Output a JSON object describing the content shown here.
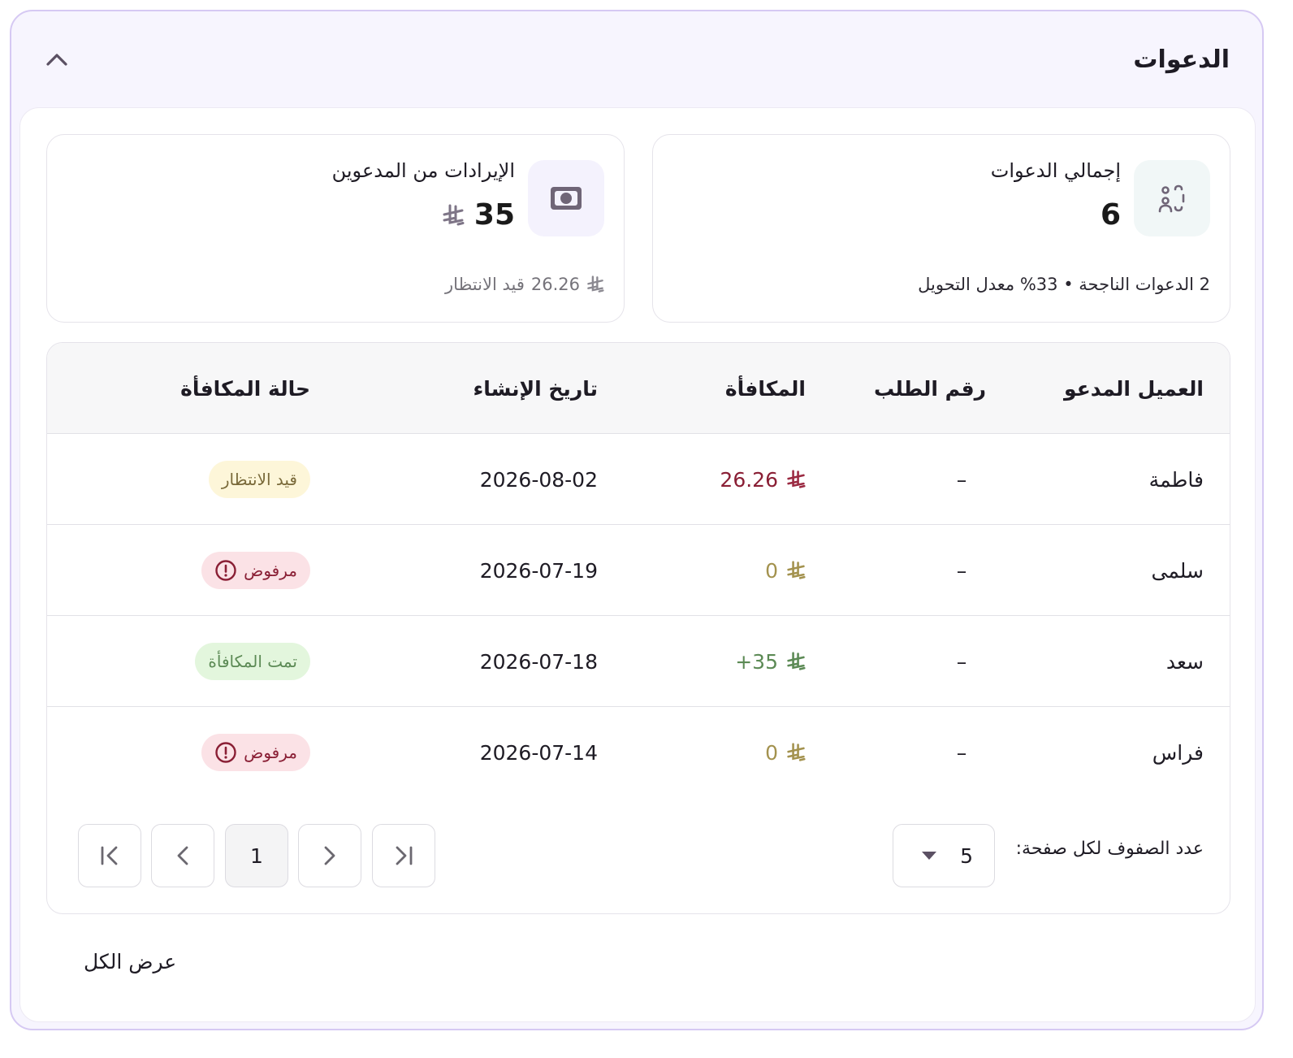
{
  "header": {
    "title": "الدعوات"
  },
  "total_invites": {
    "label": "إجمالي الدعوات",
    "value": "6",
    "summary": "2 الدعوات الناجحة • 33% معدل التحويل"
  },
  "revenue": {
    "label": "الإيرادات من المدعوين",
    "value": "35",
    "pending_amount": "26.26",
    "pending_label": "قيد الانتظار"
  },
  "table": {
    "headers": {
      "invited_customer": "العميل المدعو",
      "order_number": "رقم الطلب",
      "reward": "المكافأة",
      "created_date": "تاريخ الإنشاء",
      "reward_status": "حالة المكافأة"
    },
    "rows": [
      {
        "name": "فاطمة",
        "order": "–",
        "reward": "26.26",
        "date": "2026-08-02",
        "status": "قيد الانتظار"
      },
      {
        "name": "سلمى",
        "order": "–",
        "reward": "0",
        "date": "2026-07-19",
        "status": "مرفوض"
      },
      {
        "name": "سعد",
        "order": "–",
        "reward": "+35",
        "date": "2026-07-18",
        "status": "تمت المكافأة"
      },
      {
        "name": "فراس",
        "order": "–",
        "reward": "0",
        "date": "2026-07-14",
        "status": "مرفوض"
      }
    ]
  },
  "pagination": {
    "rows_per_page_label": "عدد الصفوف لكل صفحة:",
    "rows_per_page": "5",
    "current_page": "1"
  },
  "footer": {
    "view_all": "عرض الكل"
  },
  "colors": {
    "accent_border": "#d6c9f3",
    "panel_bg": "#f7f5fe",
    "reward_pending": "#8a1f35",
    "reward_zero": "#a3924e",
    "reward_positive": "#5c8a55",
    "icon": "#6f6577"
  }
}
